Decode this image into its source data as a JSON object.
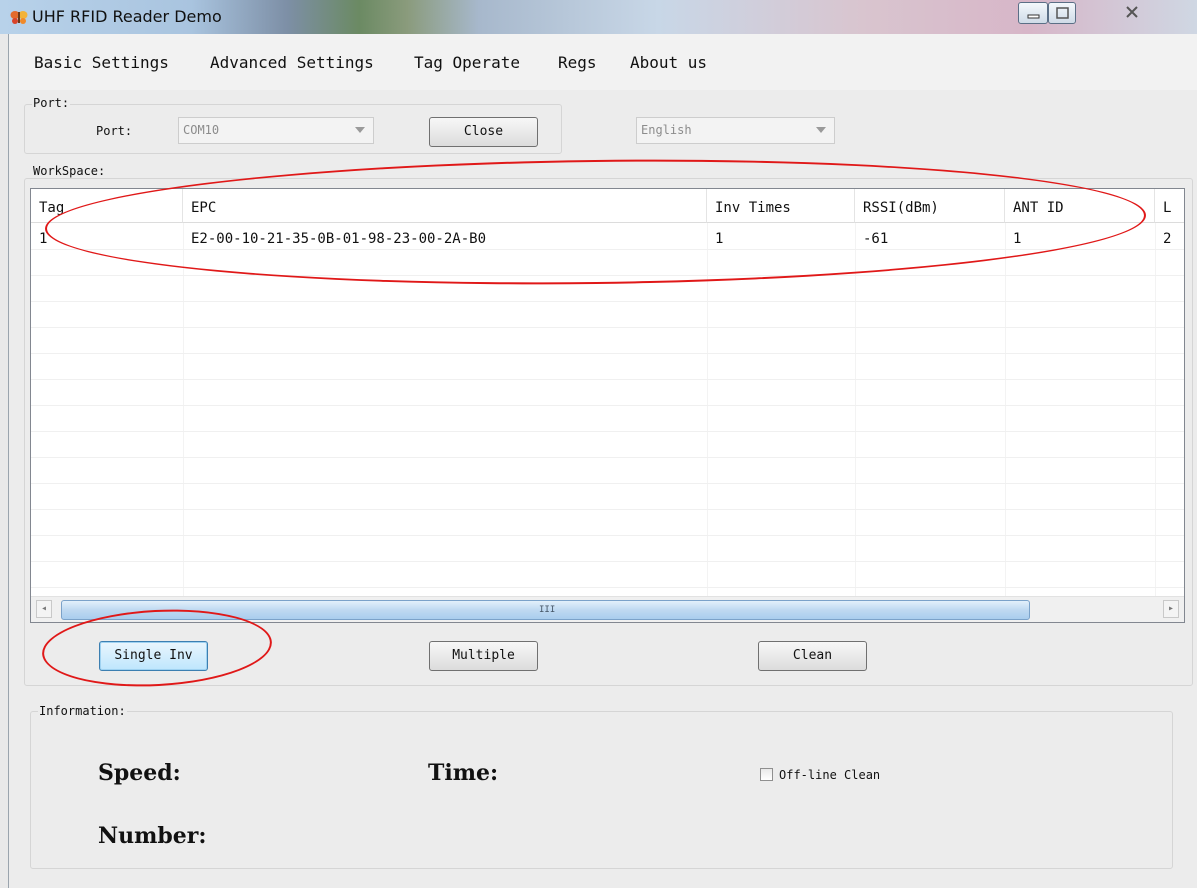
{
  "window": {
    "title": "UHF RFID Reader Demo",
    "icon": "butterfly-app-icon",
    "controls": [
      "minimize-icon",
      "maximize-icon",
      "close-icon"
    ]
  },
  "menu": [
    "Basic Settings",
    "Advanced Settings",
    "Tag Operate",
    "Regs",
    "About us"
  ],
  "port_group": {
    "legend": "Port:",
    "port_label": "Port:",
    "port_value": "COM10",
    "close_button": "Close",
    "language_value": "English"
  },
  "workspace": {
    "legend": "WorkSpace:",
    "columns": [
      "Tag",
      "EPC",
      "Inv Times",
      "RSSI(dBm)",
      "ANT ID",
      "L"
    ],
    "rows": [
      [
        "1",
        "E2-00-10-21-35-0B-01-98-23-00-2A-B0",
        "1",
        "-61",
        "1",
        "2"
      ]
    ],
    "scroll_grip": "III",
    "scroll_left": "◂",
    "scroll_right": "▸"
  },
  "actions": {
    "single_inv": "Single Inv",
    "multiple": "Multiple",
    "clean": "Clean"
  },
  "information": {
    "legend": "Information:",
    "speed_label": "Speed:",
    "time_label": "Time:",
    "number_label": "Number:",
    "offline_clean_label": "Off-line Clean",
    "offline_clean_checked": false
  },
  "annotations": {
    "color": "#e01818"
  }
}
